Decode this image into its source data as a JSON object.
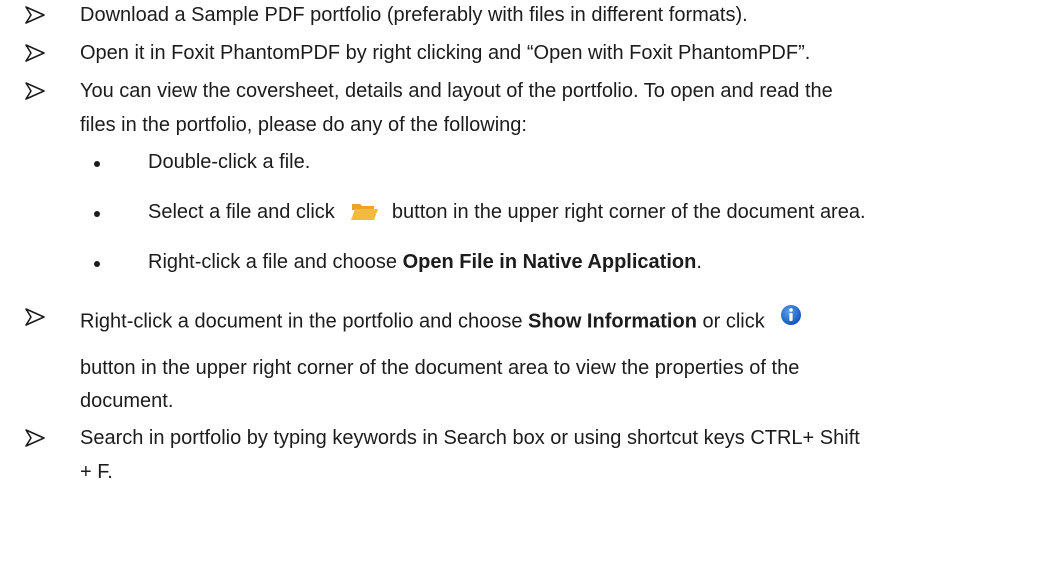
{
  "steps": {
    "s1": "Download a Sample PDF portfolio (preferably with files in different formats).",
    "s2": "Open it in Foxit PhantomPDF by right clicking and “Open with Foxit PhantomPDF”.",
    "s3_line1": "You can view the coversheet, details and layout of the portfolio. To open and read the",
    "s3_line2": "files in the portfolio, please do any of the following:",
    "sub1": "Double-click a file.",
    "sub2_before": "Select a file and click",
    "sub2_after": "button in the upper right corner of the document area.",
    "sub3_before": "Right-click a file and choose",
    "sub3_bold": "Open File in Native Application",
    "sub3_after": ".",
    "s4_before": "Right-click a document in the portfolio and choose",
    "s4_bold": "Show Information",
    "s4_after": "or click",
    "s4_line2": "button in the upper right corner of the document area to view the properties of the",
    "s4_line3": "document.",
    "s5_line1": "Search in portfolio by typing keywords in Search box or using shortcut keys CTRL+ Shift",
    "s5_line2": "+ F."
  },
  "icons": {
    "bullet": "arrowhead-check-icon",
    "folder": "open-folder-icon",
    "info": "info-icon"
  },
  "colors": {
    "text": "#1c1c1c",
    "folder": "#f4b93f",
    "info": "#1f6fd1"
  }
}
